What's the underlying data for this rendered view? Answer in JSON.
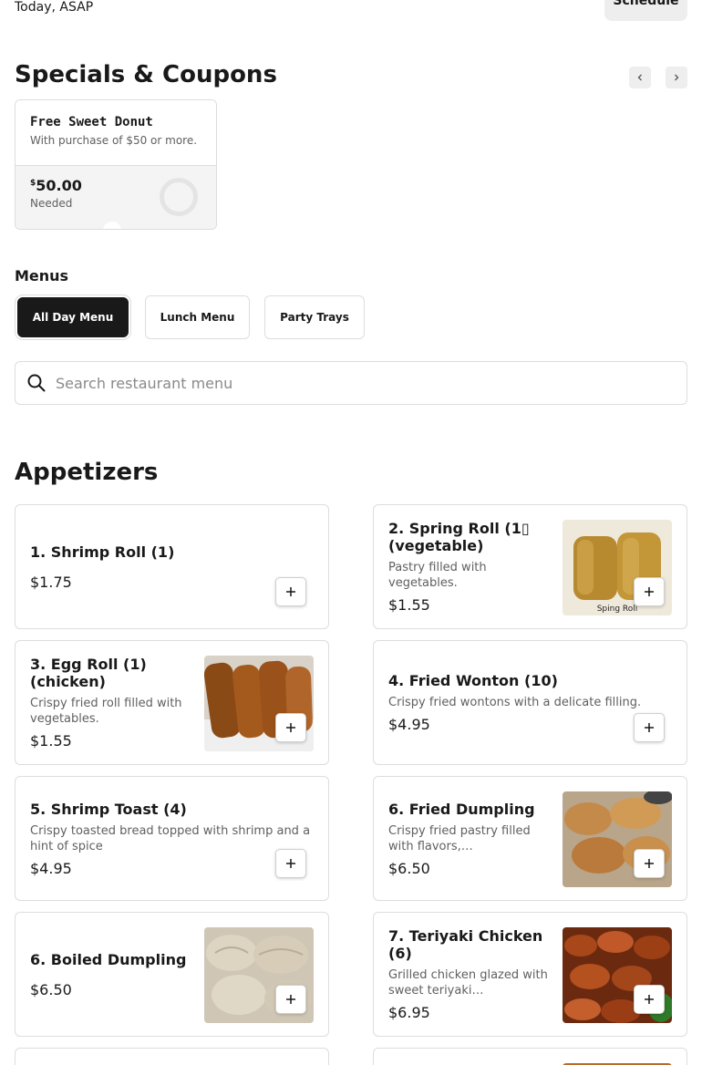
{
  "header": {
    "time_text": "Today, ASAP",
    "schedule_label": "Schedule"
  },
  "specials": {
    "title": "Specials & Coupons",
    "coupon": {
      "title": "Free Sweet Donut",
      "description": "With purchase of $50 or more.",
      "currency": "$",
      "amount": "50.00",
      "needed_label": "Needed",
      "progress": 0
    }
  },
  "menus": {
    "label": "Menus",
    "tabs": [
      {
        "label": "All Day Menu",
        "active": true
      },
      {
        "label": "Lunch Menu",
        "active": false
      },
      {
        "label": "Party Trays",
        "active": false
      }
    ]
  },
  "search": {
    "placeholder": "Search restaurant menu",
    "value": ""
  },
  "appetizers": {
    "title": "Appetizers",
    "items": [
      {
        "name": "1. Shrimp Roll (1)",
        "description": "",
        "price": "$1.75",
        "image": null
      },
      {
        "name": "2. Spring Roll (1▯ (vegetable)",
        "description": "Pastry filled with vegetables.",
        "price": "$1.55",
        "image": "spring-roll-photo",
        "image_caption": "Sping Roll"
      },
      {
        "name": "3. Egg Roll (1) (chicken)",
        "description": "Crispy fried roll filled with vegetables.",
        "price": "$1.55",
        "image": "egg-roll-photo"
      },
      {
        "name": "4. Fried Wonton (10)",
        "description": "Crispy fried wontons with a delicate filling.",
        "price": "$4.95",
        "image": null
      },
      {
        "name": "5. Shrimp Toast (4)",
        "description": "Crispy toasted bread topped with shrimp and a hint of spice",
        "price": "$4.95",
        "image": null
      },
      {
        "name": "6. Fried Dumpling",
        "description": "Crispy fried pastry filled with flavors,…",
        "price": "$6.50",
        "image": "fried-dumpling-photo"
      },
      {
        "name": "6. Boiled Dumpling",
        "description": "",
        "price": "$6.50",
        "image": "boiled-dumpling-photo"
      },
      {
        "name": "7. Teriyaki Chicken (6)",
        "description": "Grilled chicken glazed with sweet teriyaki…",
        "price": "$6.95",
        "image": "teriyaki-chicken-photo"
      }
    ]
  },
  "icons": {
    "search": "search-icon",
    "add": "plus-icon",
    "prev": "chevron-left-icon",
    "next": "chevron-right-icon"
  },
  "colors": {
    "text": "#191919",
    "muted": "#606060",
    "border": "#dddddd",
    "active_tab_bg": "#191919",
    "button_bg": "#eeeeee"
  }
}
